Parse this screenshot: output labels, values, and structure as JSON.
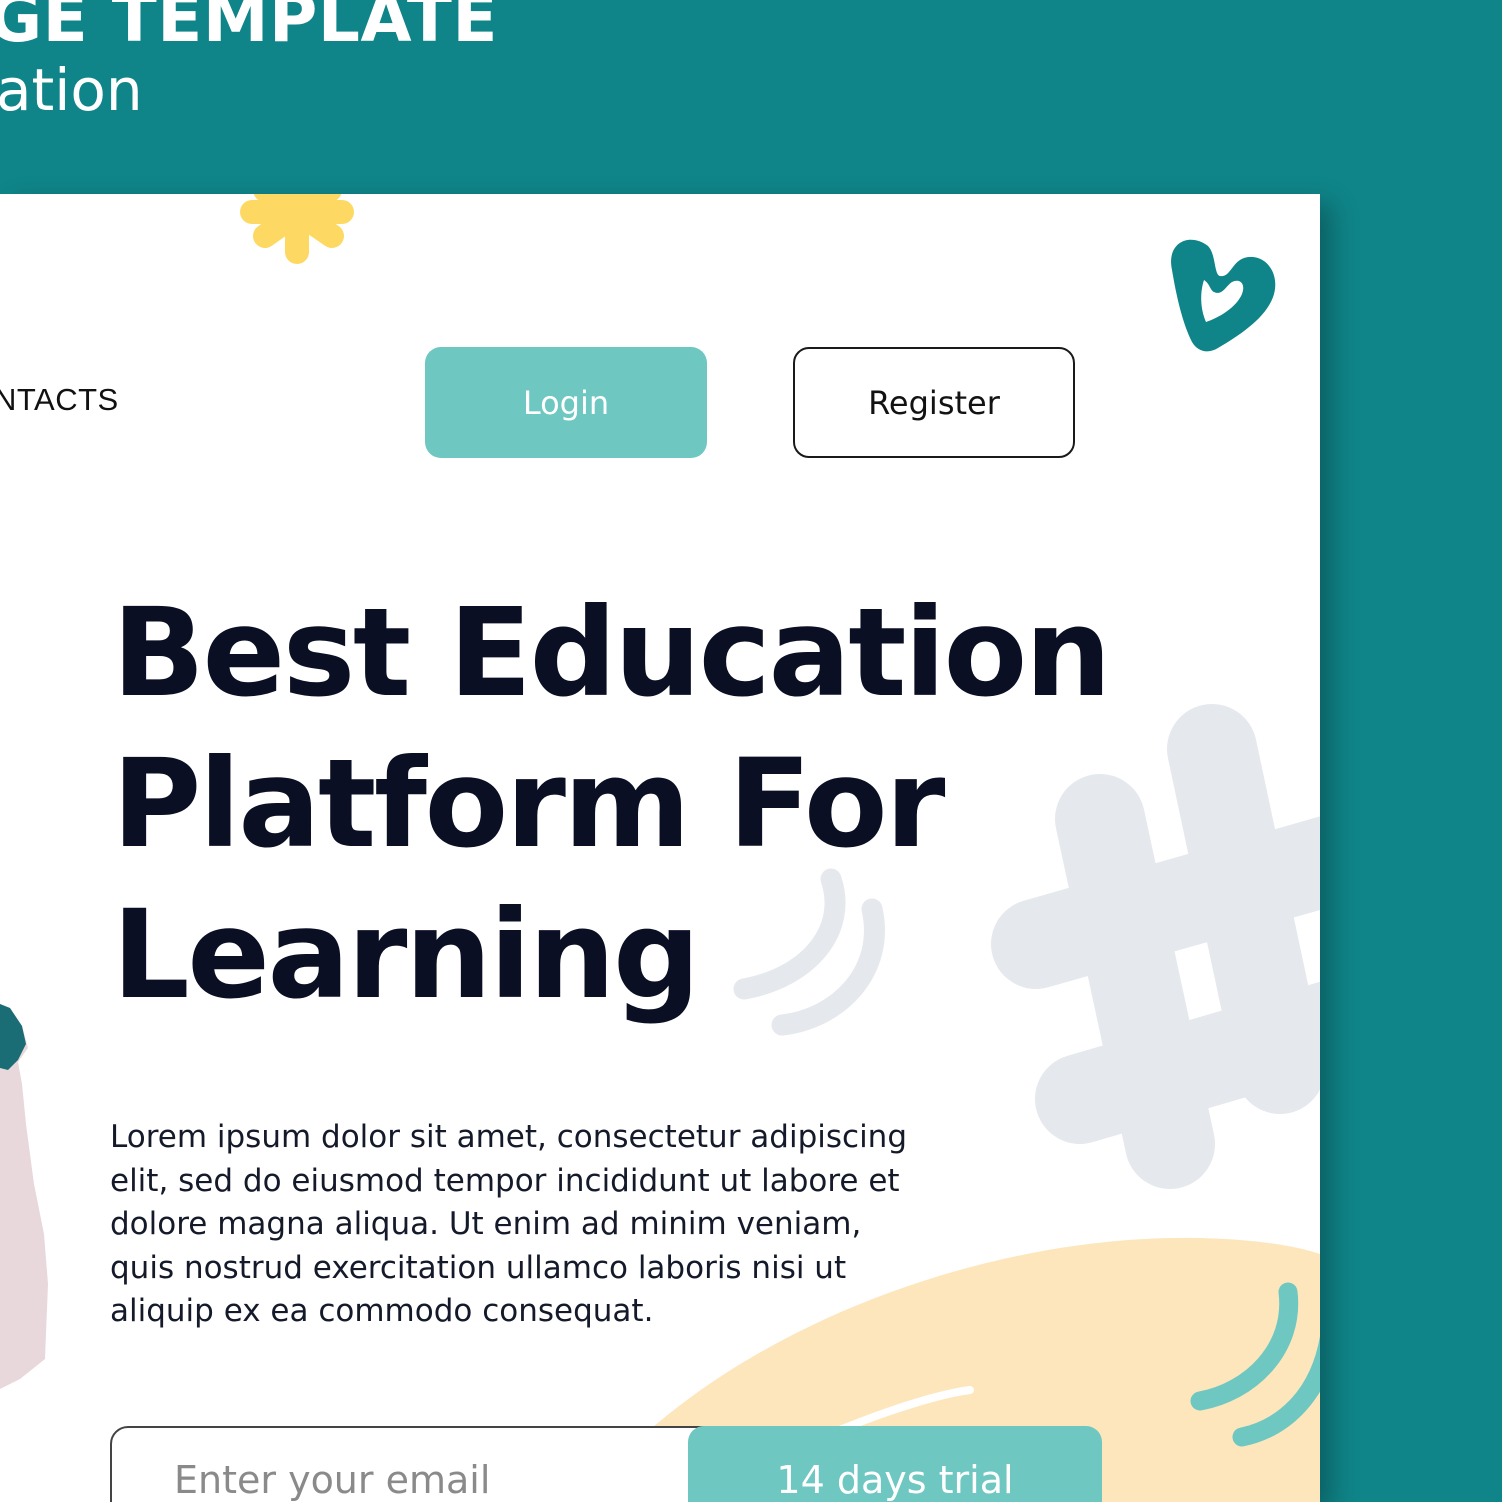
{
  "banner": {
    "title": "GE TEMPLATE",
    "subtitle": "ation"
  },
  "nav": {
    "contacts_label": "NTACTS",
    "login_label": "Login",
    "register_label": "Register"
  },
  "hero": {
    "headline_line1": "Best Education",
    "headline_line2": "Platform For",
    "headline_line3": "Learning",
    "body": "Lorem ipsum dolor sit amet, consectetur adipiscing elit, sed do eiusmod tempor incididunt ut labore et dolore magna aliqua. Ut enim ad minim veniam, quis nostrud exercitation ullamco laboris nisi ut aliquip ex ea commodo consequat."
  },
  "signup": {
    "email_placeholder": "Enter your email",
    "trial_label": "14 days trial"
  },
  "colors": {
    "background_teal": "#0f8589",
    "accent_mint": "#6fc7c2",
    "heading_navy": "#0b0f24",
    "blob_cream": "#fde6bc",
    "star_yellow": "#fdd964",
    "shape_gray": "#e5e8ed"
  },
  "icons": [
    "heart-icon",
    "asterisk-star-icon",
    "hashtag-shape",
    "swoosh-lines"
  ]
}
